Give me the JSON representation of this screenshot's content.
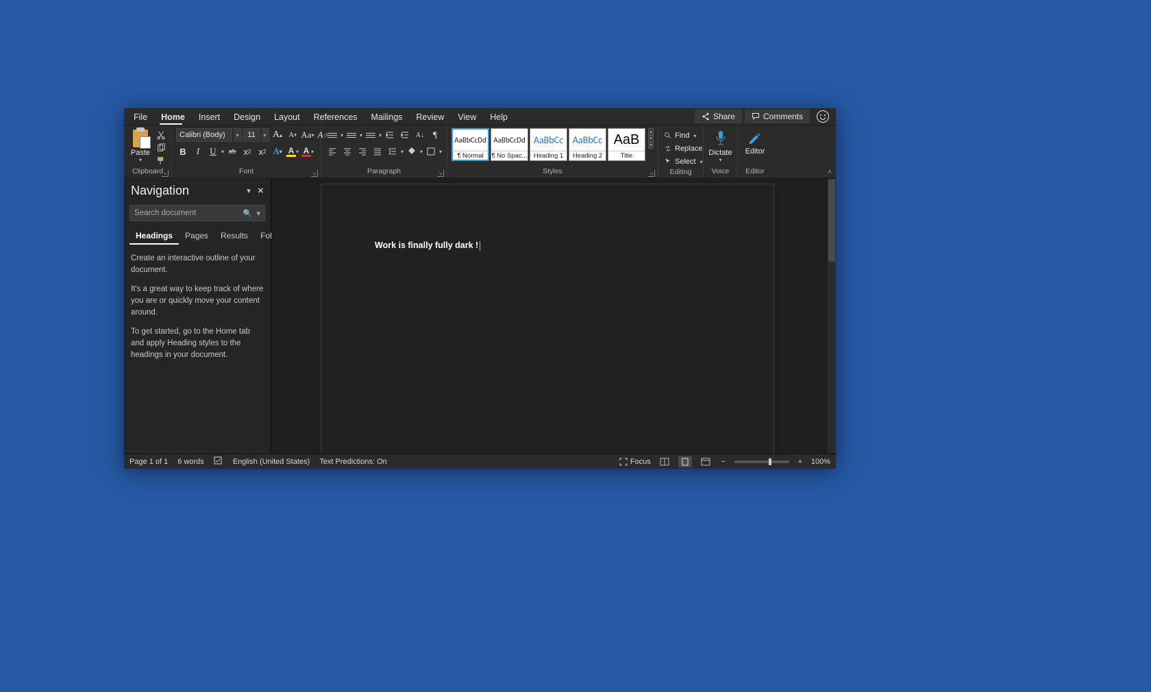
{
  "tabs": [
    "File",
    "Home",
    "Insert",
    "Design",
    "Layout",
    "References",
    "Mailings",
    "Review",
    "View",
    "Help"
  ],
  "active_tab_index": 1,
  "share_label": "Share",
  "comments_label": "Comments",
  "clipboard": {
    "paste": "Paste",
    "group": "Clipboard"
  },
  "font": {
    "name": "Calibri (Body)",
    "size": "11",
    "group": "Font",
    "buttons": {
      "bold": "B",
      "italic": "I",
      "underline": "U",
      "strike": "ab",
      "sub": "x",
      "sup": "x"
    }
  },
  "paragraph": {
    "group": "Paragraph"
  },
  "styles": {
    "group": "Styles",
    "items": [
      {
        "sample": "AaBbCcDd",
        "name": "¶ Normal",
        "variant": "normal",
        "selected": true
      },
      {
        "sample": "AaBbCcDd",
        "name": "¶ No Spac...",
        "variant": "normal"
      },
      {
        "sample": "AaBbCc",
        "name": "Heading 1",
        "variant": "blue"
      },
      {
        "sample": "AaBbCc",
        "name": "Heading 2",
        "variant": "blue"
      },
      {
        "sample": "AaB",
        "name": "Title",
        "variant": "big"
      }
    ]
  },
  "editing": {
    "group": "Editing",
    "find": "Find",
    "replace": "Replace",
    "select": "Select"
  },
  "voice": {
    "label": "Dictate",
    "group": "Voice"
  },
  "editor": {
    "label": "Editor",
    "group": "Editor"
  },
  "nav": {
    "title": "Navigation",
    "search_placeholder": "Search document",
    "tabs": [
      "Headings",
      "Pages",
      "Results",
      "Follow"
    ],
    "active_tab_index": 0,
    "p1": "Create an interactive outline of your document.",
    "p2": "It's a great way to keep track of where you are or quickly move your content around.",
    "p3": "To get started, go to the Home tab and apply Heading styles to the headings in your document."
  },
  "document": {
    "text": "Work is finally fully dark !"
  },
  "status": {
    "page": "Page 1 of 1",
    "words": "6 words",
    "lang": "English (United States)",
    "predictions": "Text Predictions: On",
    "focus": "Focus",
    "zoom": "100%"
  }
}
